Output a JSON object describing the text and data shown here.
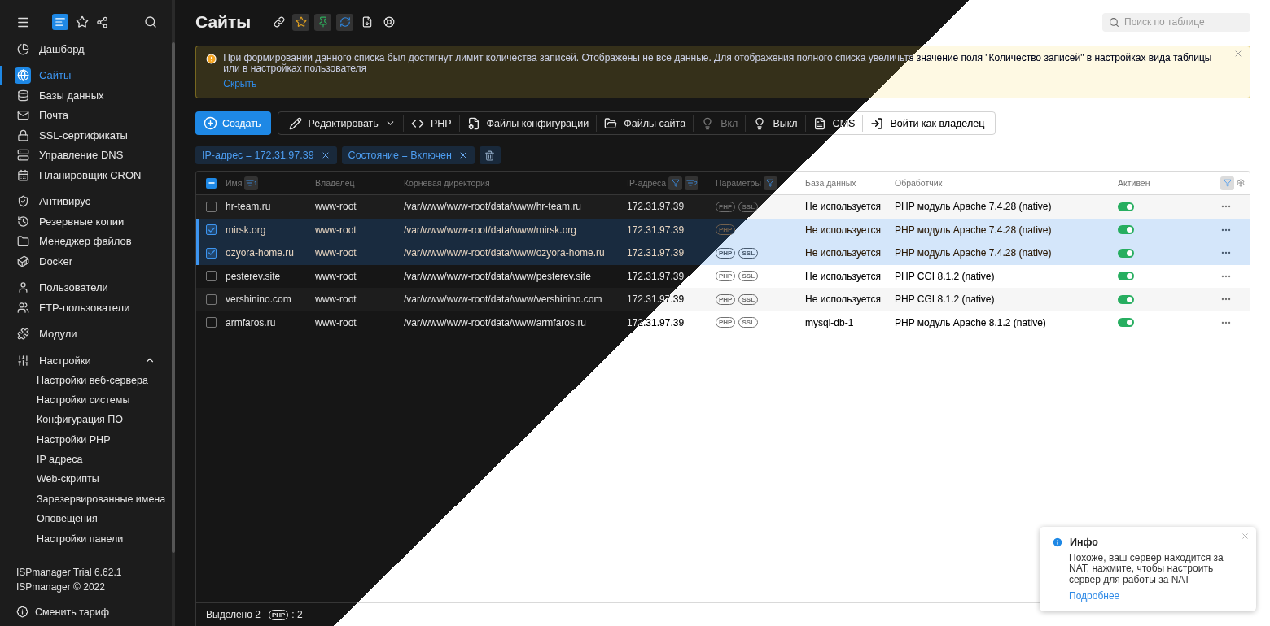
{
  "sidebar": {
    "groups": [
      [
        {
          "label": "Дашборд",
          "selected": false
        }
      ],
      [
        {
          "label": "Сайты",
          "selected": true
        },
        {
          "label": "Базы данных",
          "selected": false
        },
        {
          "label": "Почта",
          "selected": false
        },
        {
          "label": "SSL-сертификаты",
          "selected": false
        },
        {
          "label": "Управление DNS",
          "selected": false
        },
        {
          "label": "Планировщик CRON",
          "selected": false
        }
      ],
      [
        {
          "label": "Антивирус",
          "selected": false
        },
        {
          "label": "Резервные копии",
          "selected": false
        },
        {
          "label": "Менеджер файлов",
          "selected": false
        },
        {
          "label": "Docker",
          "selected": false
        }
      ],
      [
        {
          "label": "Пользователи",
          "selected": false
        },
        {
          "label": "FTP-пользователи",
          "selected": false
        }
      ],
      [
        {
          "label": "Модули",
          "selected": false
        }
      ],
      [
        {
          "label": "Настройки",
          "selected": false,
          "expanded": true,
          "children": [
            {
              "label": "Настройки веб-сервера"
            },
            {
              "label": "Настройки системы"
            },
            {
              "label": "Конфигурация ПО"
            },
            {
              "label": "Настройки PHP"
            },
            {
              "label": "IP адреса"
            },
            {
              "label": "Web-скрипты"
            },
            {
              "label": "Зарезервированные имена"
            },
            {
              "label": "Оповещения"
            },
            {
              "label": "Настройки панели"
            }
          ]
        }
      ]
    ],
    "version": "ISPmanager Trial 6.62.1",
    "copyright": "ISPmanager © 2022",
    "tariff": "Сменить тариф"
  },
  "page": {
    "title": "Сайты",
    "search": {
      "placeholder": "Поиск по таблице"
    }
  },
  "banner": {
    "text": "При формировании данного списка был достигнут лимит количества записей. Отображены не все данные. Для отображения полного списка увеличьте значение поля \"Количество записей\" в настройках вида таблицы или в настройках пользователя",
    "link": "Скрыть"
  },
  "toolbar": {
    "create": "Создать",
    "buttons": [
      {
        "label": "Редактировать",
        "dropdown": true,
        "disabled": false
      },
      {
        "label": "PHP",
        "dropdown": false,
        "disabled": false
      },
      {
        "label": "Файлы конфигурации",
        "dropdown": false,
        "disabled": false
      },
      {
        "label": "Файлы сайта",
        "dropdown": false,
        "disabled": false
      },
      {
        "label": "Вкл",
        "dropdown": false,
        "disabled": true
      },
      {
        "label": "Выкл",
        "dropdown": false,
        "disabled": false
      },
      {
        "label": "CMS",
        "dropdown": false,
        "disabled": false
      },
      {
        "label": "Войти как владелец",
        "dropdown": false,
        "disabled": false
      }
    ]
  },
  "filters": [
    {
      "text": "IP-адрес = 172.31.97.39"
    },
    {
      "text": "Состояние = Включен"
    }
  ],
  "table": {
    "select_all": {
      "indeterminate": true
    },
    "columns": [
      {
        "label": "Имя",
        "filter": false,
        "sort": "1"
      },
      {
        "label": "Владелец",
        "filter": false
      },
      {
        "label": "Корневая директория",
        "filter": false
      },
      {
        "label": "IP-адреса",
        "filter": true,
        "sort": "2"
      },
      {
        "label": "Параметры",
        "filter": true
      },
      {
        "label": "База данных",
        "filter": false
      },
      {
        "label": "Обработчик",
        "filter": false
      },
      {
        "label": "Активен",
        "filter": false
      }
    ],
    "rows": [
      {
        "name": "hr-team.ru",
        "owner": "www-root",
        "root": "/var/www/www-root/data/www/hr-team.ru",
        "ip": "172.31.97.39",
        "params": [
          "PHP",
          "SSL"
        ],
        "database": "Не используется",
        "handler": "PHP модуль Apache 7.4.28 (native)",
        "active": true,
        "selected": false
      },
      {
        "name": "mirsk.org",
        "owner": "www-root",
        "root": "/var/www/www-root/data/www/mirsk.org",
        "ip": "172.31.97.39",
        "params": [
          "PHP"
        ],
        "database": "Не используется",
        "handler": "PHP модуль Apache 7.4.28 (native)",
        "active": true,
        "selected": true
      },
      {
        "name": "ozyora-home.ru",
        "owner": "www-root",
        "root": "/var/www/www-root/data/www/ozyora-home.ru",
        "ip": "172.31.97.39",
        "params": [
          "PHP",
          "SSL"
        ],
        "database": "Не используется",
        "handler": "PHP модуль Apache 7.4.28 (native)",
        "active": true,
        "selected": true
      },
      {
        "name": "pesterev.site",
        "owner": "www-root",
        "root": "/var/www/www-root/data/www/pesterev.site",
        "ip": "172.31.97.39",
        "params": [
          "PHP",
          "SSL"
        ],
        "database": "Не используется",
        "handler": "PHP CGI 8.1.2 (native)",
        "active": true,
        "selected": false
      },
      {
        "name": "vershinino.com",
        "owner": "www-root",
        "root": "/var/www/www-root/data/www/vershinino.com",
        "ip": "172.31.97.39",
        "params": [
          "PHP",
          "SSL"
        ],
        "database": "Не используется",
        "handler": "PHP CGI 8.1.2 (native)",
        "active": true,
        "selected": false
      },
      {
        "name": "armfaros.ru",
        "owner": "www-root",
        "root": "/var/www/www-root/data/www/armfaros.ru",
        "ip": "172.31.97.39",
        "params": [
          "PHP",
          "SSL"
        ],
        "database": "mysql-db-1",
        "handler": "PHP модуль Apache 8.1.2 (native)",
        "active": true,
        "selected": false
      }
    ],
    "footer": {
      "selected": "Выделено 2",
      "badge": "PHP",
      "count": ": 2"
    }
  },
  "toast": {
    "title": "Инфо",
    "text": "Похоже, ваш сервер находится за NAT, нажмите, чтобы настроить сервер для работы за NAT",
    "link": "Подробнее"
  }
}
